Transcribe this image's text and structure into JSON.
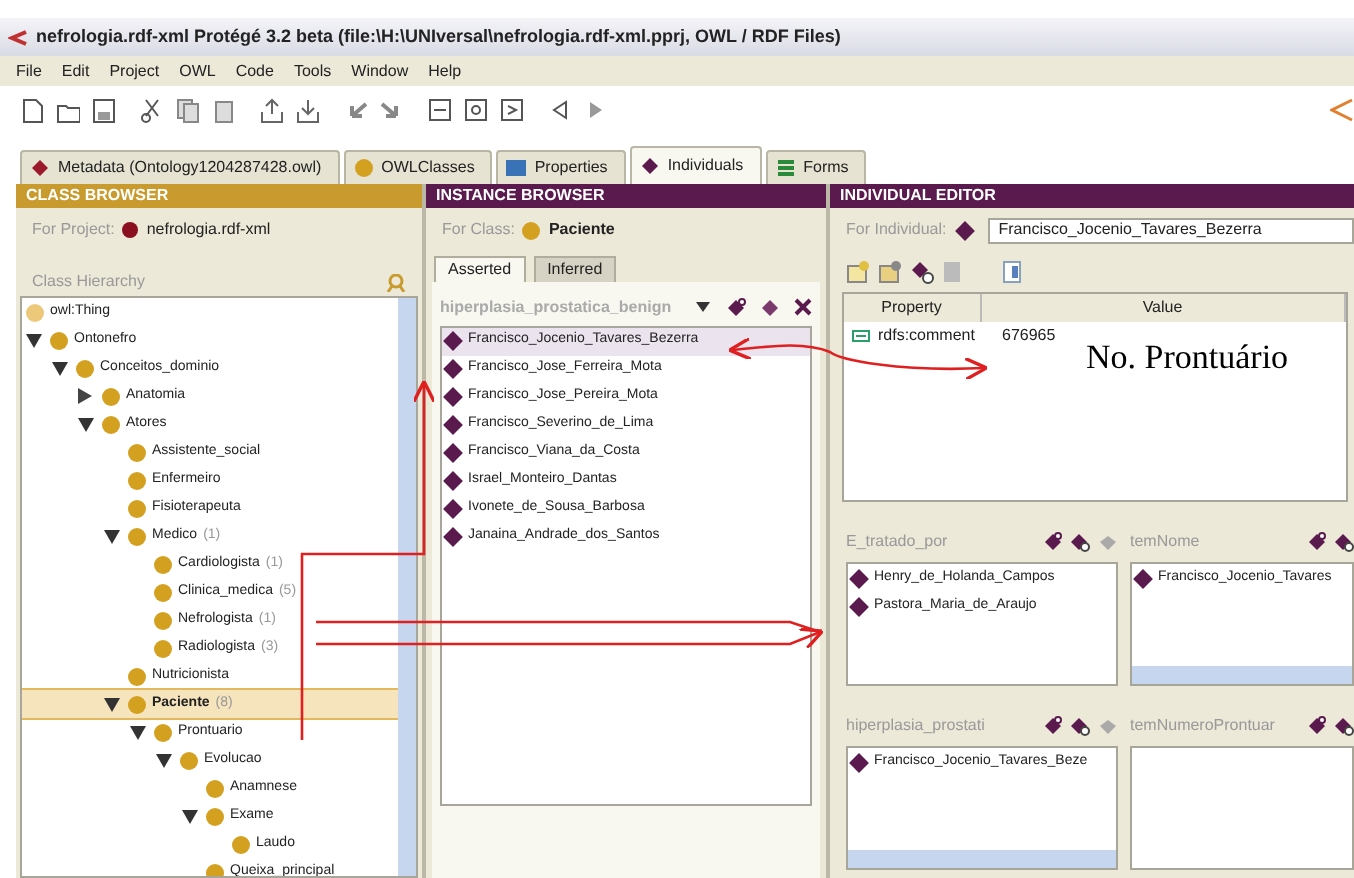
{
  "window": {
    "title": "nefrologia.rdf-xml  Protégé 3.2 beta    (file:\\H:\\UNIversal\\nefrologia.rdf-xml.pprj, OWL / RDF Files)"
  },
  "menu": [
    "File",
    "Edit",
    "Project",
    "OWL",
    "Code",
    "Tools",
    "Window",
    "Help"
  ],
  "tabs": [
    {
      "label": "Metadata (Ontology1204287428.owl)",
      "kind": "metadata",
      "selected": false
    },
    {
      "label": "OWLClasses",
      "kind": "classes",
      "selected": false
    },
    {
      "label": "Properties",
      "kind": "properties",
      "selected": false
    },
    {
      "label": "Individuals",
      "kind": "individuals",
      "selected": true
    },
    {
      "label": "Forms",
      "kind": "forms",
      "selected": false
    }
  ],
  "class_browser": {
    "header": "CLASS BROWSER",
    "for_label": "For Project:",
    "project": "nefrologia.rdf-xml",
    "hierarchy_label": "Class Hierarchy",
    "tree": [
      {
        "label": "owl:Thing",
        "kind": "root",
        "selected": false,
        "children": [
          {
            "label": "Ontonefro",
            "expanded": true,
            "selected": false,
            "children": [
              {
                "label": "Conceitos_dominio",
                "expanded": true,
                "selected": false,
                "children": [
                  {
                    "label": "Anatomia",
                    "expanded": false,
                    "selected": false
                  },
                  {
                    "label": "Atores",
                    "expanded": true,
                    "selected": false,
                    "children": [
                      {
                        "label": "Assistente_social",
                        "selected": false
                      },
                      {
                        "label": "Enfermeiro",
                        "selected": false
                      },
                      {
                        "label": "Fisioterapeuta",
                        "selected": false
                      },
                      {
                        "label": "Medico",
                        "count": "(1)",
                        "expanded": true,
                        "selected": false,
                        "children": [
                          {
                            "label": "Cardiologista",
                            "count": "(1)",
                            "selected": false
                          },
                          {
                            "label": "Clinica_medica",
                            "count": "(5)",
                            "selected": false
                          },
                          {
                            "label": "Nefrologista",
                            "count": "(1)",
                            "selected": false
                          },
                          {
                            "label": "Radiologista",
                            "count": "(3)",
                            "selected": false
                          }
                        ]
                      },
                      {
                        "label": "Nutricionista",
                        "selected": false
                      },
                      {
                        "label": "Paciente",
                        "count": "(8)",
                        "selected": true,
                        "expanded": true,
                        "children": [
                          {
                            "label": "Prontuario",
                            "expanded": true,
                            "selected": false,
                            "children": [
                              {
                                "label": "Evolucao",
                                "expanded": true,
                                "selected": false,
                                "children": [
                                  {
                                    "label": "Anamnese",
                                    "selected": false
                                  },
                                  {
                                    "label": "Exame",
                                    "expanded": true,
                                    "selected": false,
                                    "children": [
                                      {
                                        "label": "Laudo",
                                        "selected": false
                                      }
                                    ]
                                  },
                                  {
                                    "label": "Queixa_principal",
                                    "selected": false
                                  }
                                ]
                              }
                            ]
                          }
                        ]
                      }
                    ]
                  }
                ]
              }
            ]
          }
        ]
      }
    ]
  },
  "instance_browser": {
    "header": "INSTANCE BROWSER",
    "for_label": "For Class:",
    "class": "Paciente",
    "subtabs": [
      {
        "label": "Asserted",
        "selected": true
      },
      {
        "label": "Inferred",
        "selected": false
      }
    ],
    "filter": "hiperplasia_prostatica_benign",
    "instances": [
      {
        "label": "Francisco_Jocenio_Tavares_Bezerra",
        "selected": true
      },
      {
        "label": "Francisco_Jose_Ferreira_Mota",
        "selected": false
      },
      {
        "label": "Francisco_Jose_Pereira_Mota",
        "selected": false
      },
      {
        "label": "Francisco_Severino_de_Lima",
        "selected": false
      },
      {
        "label": "Francisco_Viana_da_Costa",
        "selected": false
      },
      {
        "label": "Israel_Monteiro_Dantas",
        "selected": false
      },
      {
        "label": "Ivonete_de_Sousa_Barbosa",
        "selected": false
      },
      {
        "label": "Janaina_Andrade_dos_Santos",
        "selected": false
      }
    ]
  },
  "individual_editor": {
    "header": "INDIVIDUAL EDITOR",
    "for_label": "For Individual:",
    "individual": "Francisco_Jocenio_Tavares_Bezerra",
    "table": {
      "columns": [
        "Property",
        "Value"
      ],
      "rows": [
        {
          "property": "rdfs:comment",
          "value": "676965"
        }
      ]
    },
    "widgets": [
      {
        "label": "E_tratado_por",
        "items": [
          "Henry_de_Holanda_Campos",
          "Pastora_Maria_de_Araujo"
        ],
        "hscroll": false
      },
      {
        "label": "temNome",
        "items": [
          "Francisco_Jocenio_Tavares"
        ],
        "hscroll": true
      },
      {
        "label": "hiperplasia_prostati",
        "items": [
          "Francisco_Jocenio_Tavares_Beze"
        ],
        "hscroll": true
      },
      {
        "label": "temNumeroProntuar",
        "hscroll": false
      }
    ]
  },
  "annotation": {
    "text": "No. Prontuário"
  }
}
